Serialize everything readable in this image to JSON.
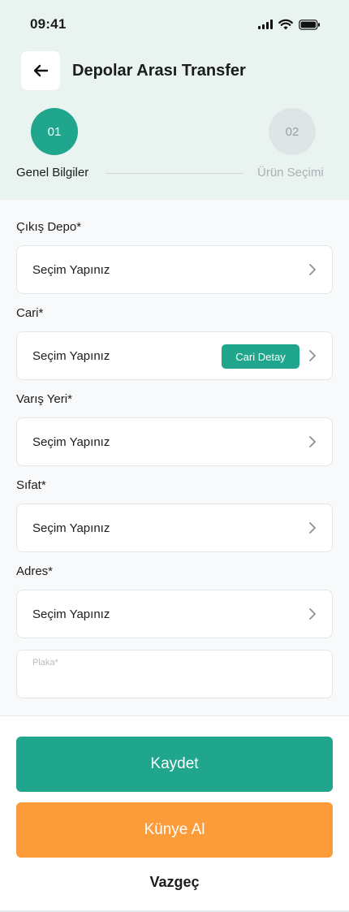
{
  "status_bar": {
    "time": "09:41"
  },
  "header": {
    "title": "Depolar Arası Transfer",
    "back_icon": "arrow-left-icon"
  },
  "stepper": {
    "steps": [
      {
        "number": "01",
        "label": "Genel Bilgiler",
        "active": true
      },
      {
        "number": "02",
        "label": "Ürün Seçimi",
        "active": false
      }
    ]
  },
  "form": {
    "fields": [
      {
        "label": "Çıkış Depo*",
        "value": "Seçim Yapınız"
      },
      {
        "label": "Cari*",
        "value": "Seçim Yapınız",
        "action": "Cari Detay"
      },
      {
        "label": "Varış Yeri*",
        "value": "Seçim Yapınız"
      },
      {
        "label": "Sıfat*",
        "value": "Seçim Yapınız"
      },
      {
        "label": "Adres*",
        "value": "Seçim Yapınız"
      }
    ],
    "plate": {
      "placeholder": "Plaka*",
      "value": ""
    }
  },
  "actions": {
    "save": "Kaydet",
    "kunye": "Künye Al",
    "cancel": "Vazgeç"
  },
  "colors": {
    "primary": "#1fa68c",
    "orange": "#fc9b39",
    "header_bg": "#e9f4f1"
  }
}
